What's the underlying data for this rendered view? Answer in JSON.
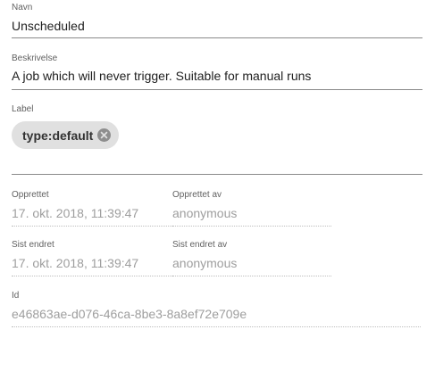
{
  "form": {
    "name": {
      "label": "Navn",
      "value": "Unscheduled"
    },
    "description": {
      "label": "Beskrivelse",
      "value": "A job which will never trigger. Suitable for manual runs"
    },
    "labels": {
      "label": "Label",
      "chips": [
        {
          "text": "type:default",
          "remove_icon": "cancel-circle-icon"
        }
      ]
    },
    "created": {
      "label": "Opprettet",
      "value": "17. okt. 2018, 11:39:47"
    },
    "created_by": {
      "label": "Opprettet av",
      "value": "anonymous"
    },
    "changed": {
      "label": "Sist endret",
      "value": "17. okt. 2018, 11:39:47"
    },
    "changed_by": {
      "label": "Sist endret av",
      "value": "anonymous"
    },
    "id": {
      "label": "Id",
      "value": "e46863ae-d076-46ca-8be3-8a8ef72e709e"
    }
  },
  "colors": {
    "chip_background": "#e0e0e0",
    "chip_icon": "#8e8e8e",
    "underline": "#8a8a8a",
    "disabled_text": "#9e9e9e",
    "label_text": "#616161"
  }
}
